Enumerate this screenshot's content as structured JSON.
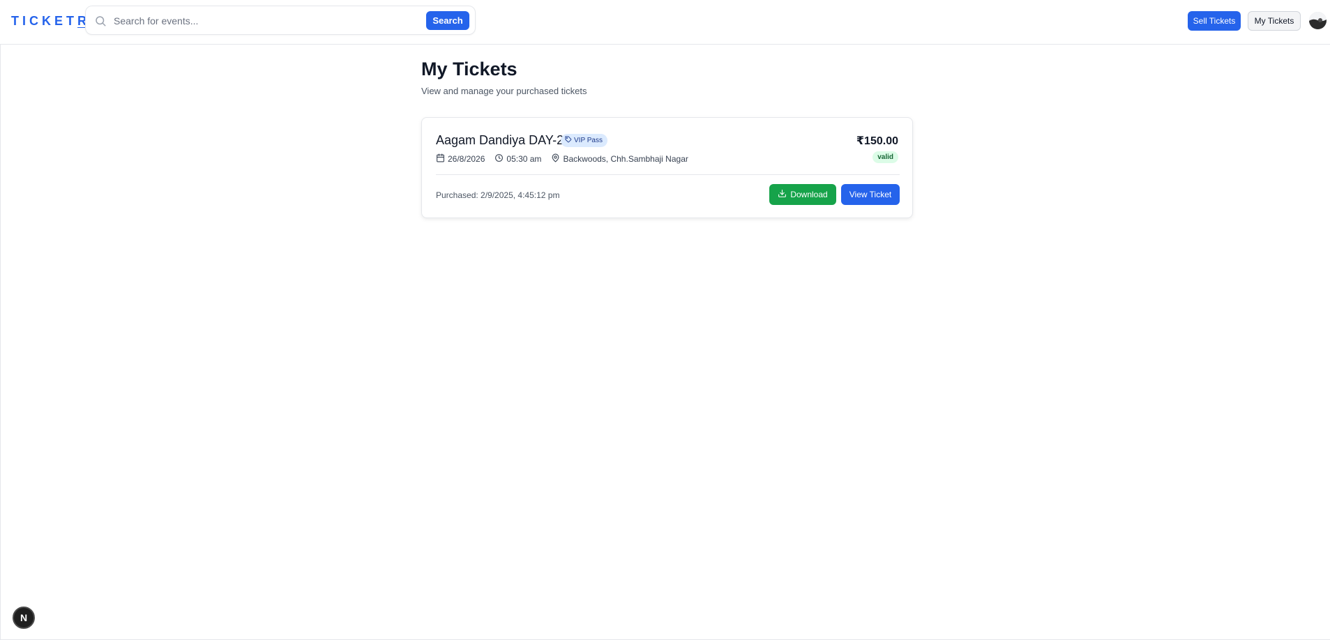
{
  "header": {
    "logo_main": "TICKET",
    "logo_last": "R",
    "search": {
      "placeholder": "Search for events...",
      "value": "",
      "button_label": "Search"
    },
    "sell_tickets_label": "Sell Tickets",
    "my_tickets_label": "My Tickets"
  },
  "main": {
    "title": "My Tickets",
    "subtitle": "View and manage your purchased tickets",
    "tickets": [
      {
        "event_name": "Aagam Dandiya DAY-2",
        "ticket_type": "VIP Pass",
        "price": "₹150.00",
        "status": "valid",
        "date": "26/8/2026",
        "time": "05:30 am",
        "location": "Backwoods, Chh.Sambhaji Nagar",
        "purchased": "Purchased: 2/9/2025, 4:45:12 pm",
        "download_label": "Download",
        "view_label": "View Ticket"
      }
    ]
  },
  "dev_indicator": {
    "label": "N"
  },
  "colors": {
    "primary": "#2563eb",
    "success": "#16a34a",
    "badge_bg": "#dbeafe",
    "status_bg": "#dcfce7"
  },
  "icons": [
    "search-icon",
    "tag-icon",
    "calendar-icon",
    "clock-icon",
    "map-pin-icon",
    "download-icon"
  ]
}
